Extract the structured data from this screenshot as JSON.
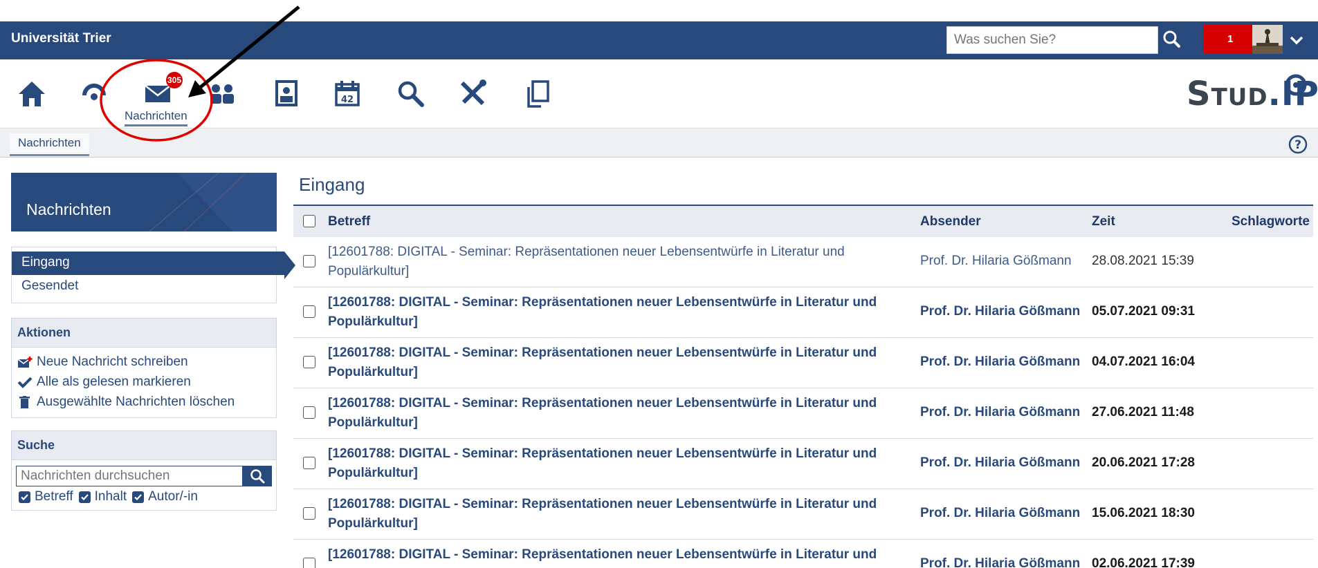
{
  "topbar": {
    "university": "Universität Trier",
    "search_placeholder": "Was suchen Sie?",
    "notification_count": "1"
  },
  "nav": {
    "active_label": "Nachrichten",
    "unread_badge": "305",
    "logo_text_a": "Stud",
    "logo_text_b": ".IP"
  },
  "subnav": {
    "tab": "Nachrichten"
  },
  "sidebar": {
    "header": "Nachrichten",
    "folders": [
      {
        "label": "Eingang"
      },
      {
        "label": "Gesendet"
      }
    ],
    "actions_title": "Aktionen",
    "actions": [
      {
        "label": "Neue Nachricht schreiben",
        "icon": "compose-mail-icon"
      },
      {
        "label": "Alle als gelesen markieren",
        "icon": "checkmark-icon"
      },
      {
        "label": "Ausgewählte Nachrichten löschen",
        "icon": "trash-icon"
      }
    ],
    "search_title": "Suche",
    "search_placeholder": "Nachrichten durchsuchen",
    "filters": [
      {
        "label": "Betreff",
        "checked": true
      },
      {
        "label": "Inhalt",
        "checked": true
      },
      {
        "label": "Autor/-in",
        "checked": true
      }
    ]
  },
  "main": {
    "title": "Eingang",
    "columns": {
      "subject": "Betreff",
      "sender": "Absender",
      "time": "Zeit",
      "tags": "Schlagworte"
    },
    "messages": [
      {
        "subject_l1": "[12601788: DIGITAL - Seminar: Repräsentationen neuer Lebensentwürfe in Literatur und",
        "subject_l2": "Populärkultur]",
        "sender": "Prof. Dr. Hilaria Gößmann",
        "time": "28.08.2021 15:39",
        "read": true
      },
      {
        "subject_l1": "[12601788: DIGITAL - Seminar: Repräsentationen neuer Lebensentwürfe in Literatur und",
        "subject_l2": "Populärkultur]",
        "sender": "Prof. Dr. Hilaria Gößmann",
        "time": "05.07.2021 09:31",
        "read": false
      },
      {
        "subject_l1": "[12601788: DIGITAL - Seminar: Repräsentationen neuer Lebensentwürfe in Literatur und",
        "subject_l2": "Populärkultur]",
        "sender": "Prof. Dr. Hilaria Gößmann",
        "time": "04.07.2021 16:04",
        "read": false
      },
      {
        "subject_l1": "[12601788: DIGITAL - Seminar: Repräsentationen neuer Lebensentwürfe in Literatur und",
        "subject_l2": "Populärkultur]",
        "sender": "Prof. Dr. Hilaria Gößmann",
        "time": "27.06.2021 11:48",
        "read": false
      },
      {
        "subject_l1": "[12601788: DIGITAL - Seminar: Repräsentationen neuer Lebensentwürfe in Literatur und",
        "subject_l2": "Populärkultur]",
        "sender": "Prof. Dr. Hilaria Gößmann",
        "time": "20.06.2021 17:28",
        "read": false
      },
      {
        "subject_l1": "[12601788: DIGITAL - Seminar: Repräsentationen neuer Lebensentwürfe in Literatur und",
        "subject_l2": "Populärkultur]",
        "sender": "Prof. Dr. Hilaria Gößmann",
        "time": "15.06.2021 18:30",
        "read": false
      },
      {
        "subject_l1": "[12601788: DIGITAL - Seminar: Repräsentationen neuer Lebensentwürfe in Literatur und",
        "subject_l2": "",
        "sender": "Prof. Dr. Hilaria Gößmann",
        "time": "02.06.2021 17:39",
        "read": false
      }
    ]
  },
  "colors": {
    "brand": "#28497c",
    "badge": "#d60000",
    "annotation": "#e00000"
  }
}
